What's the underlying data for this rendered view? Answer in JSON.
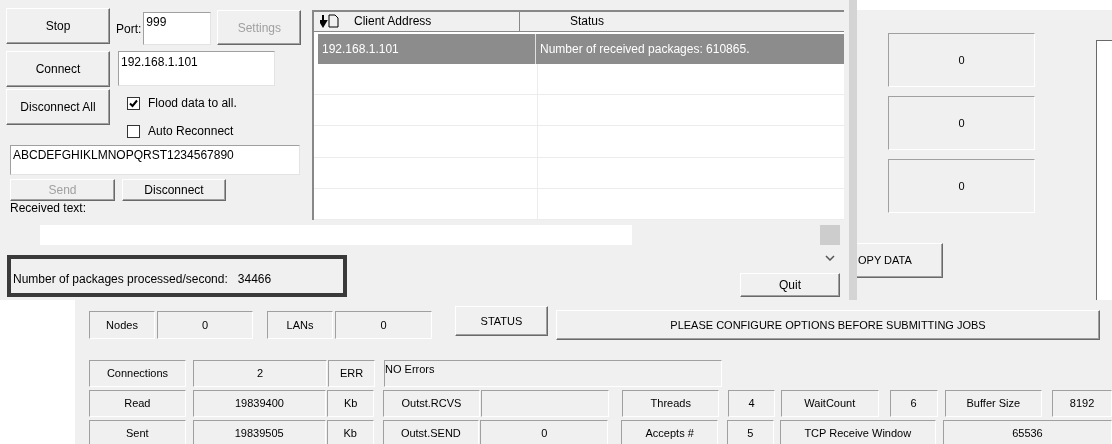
{
  "client_window": {
    "stop_button": "Stop",
    "port_label": "Port:",
    "port_value": "999",
    "settings_button": {
      "label": "Settings",
      "disabled": true
    },
    "connect_button": "Connect",
    "address_value": "192.168.1.101",
    "disconnect_all_button": "Disconnect All",
    "checkboxes": [
      {
        "label": "Flood data to all.",
        "checked": true
      },
      {
        "label": "Auto Reconnect",
        "checked": false
      }
    ],
    "message_value": "ABCDEFGHIKLMNOPQRST1234567890",
    "send_button": {
      "label": "Send",
      "disabled": true
    },
    "disconnect_button": {
      "label": "Disconnect",
      "disabled": false
    },
    "received_label": "Received text:",
    "client_table": {
      "columns": [
        "Client Address",
        "Status"
      ],
      "rows": [
        {
          "cells": [
            "192.168.1.101",
            "Number of received packages: 610865."
          ],
          "selected": true
        }
      ]
    },
    "quit_button": "Quit"
  },
  "rate_window": {
    "label": "Number of packages processed/second:",
    "value": "34466"
  },
  "monitor": {
    "counters": [
      "0",
      "0",
      "0"
    ],
    "copy_button": "OPY DATA",
    "nodes_label": "Nodes",
    "nodes_value": "0",
    "lans_label": "LANs",
    "lans_value": "0",
    "status_button": "STATUS",
    "message": "PLEASE CONFIGURE OPTIONS BEFORE SUBMITTING JOBS",
    "stats_rows": [
      [
        "Connections",
        "2",
        "ERR",
        "NO Errors"
      ],
      [
        "Read",
        "19839400",
        "Kb",
        "Outst.RCVS",
        "",
        "Threads",
        "4",
        "WaitCount",
        "6",
        "Buffer Size",
        "8192"
      ],
      [
        "Sent",
        "19839505",
        "Kb",
        "Outst.SEND",
        "0",
        "Accepts #",
        "5",
        "TCP Receive Window",
        "65536"
      ]
    ]
  }
}
